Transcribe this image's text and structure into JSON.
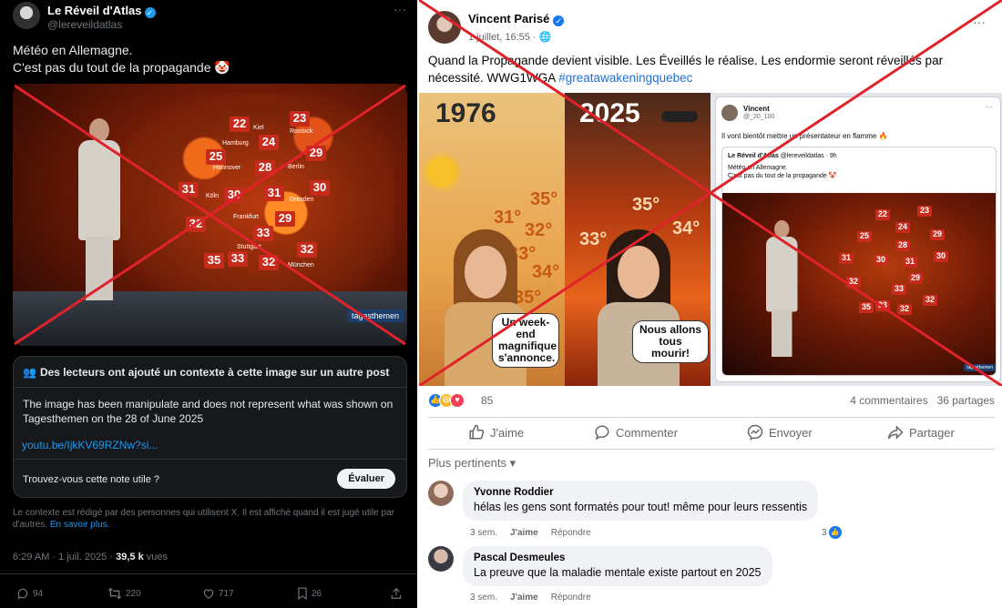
{
  "x_post": {
    "author_name": "Le Réveil d'Atlas",
    "author_handle": "@lereveildatlas",
    "more_label": "···",
    "text_lines": [
      "Météo en Allemagne.",
      "C'est pas du tout de la propagande 🤡"
    ],
    "image": {
      "channel_logo": "tagesthemen",
      "temperatures": [
        "22",
        "23",
        "24",
        "29",
        "25",
        "28",
        "30",
        "31",
        "30",
        "31",
        "32",
        "29",
        "33",
        "32",
        "35",
        "33",
        "32"
      ],
      "cities": [
        "Kiel",
        "Rostock",
        "Hamburg",
        "Hannover",
        "Berlin",
        "Köln",
        "Dresden",
        "Frankfurt",
        "Stuttgart",
        "München"
      ]
    },
    "community_note": {
      "header": "Des lecteurs ont ajouté un contexte à cette image sur un autre post",
      "body": "The image has been manipulate and does not represent what was shown on Tagesthemen on the  28 of June 2025",
      "link": "youtu.be/IjkKV69RZNw?si...",
      "question": "Trouvez-vous cette note utile ?",
      "rate_button": "Évaluer"
    },
    "disclaimer": "Le contexte est rédigé par des personnes qui utilisent X. Il est affiché quand il est jugé utile par d'autres.",
    "learn_more": "En savoir plus.",
    "timestamp": "6:29 AM · 1 juil. 2025 · ",
    "views_count": "39,5 k",
    "views_label": " vues",
    "actions": {
      "replies": "94",
      "reposts": "220",
      "likes": "717",
      "bookmarks": "26"
    },
    "icons": [
      "verified-badge-icon",
      "reply-icon",
      "repost-icon",
      "like-icon",
      "bookmark-icon",
      "share-icon",
      "people-icon"
    ]
  },
  "fb_post": {
    "author_name": "Vincent Parisé",
    "date": "1 juillet, 16:55 · 🌐",
    "more_label": "···",
    "text": "Quand la Propagande devient visible. Les Éveillés le réalise. Les endormie seront réveillés par nécessité. WWG1WGA ",
    "hashtag": "#greatawakeningquebec",
    "meme": {
      "year_left": "1976",
      "year_right": "2025",
      "temps_left": [
        "35°",
        "31°",
        "32°",
        "33°",
        "34°",
        "35°"
      ],
      "temps_right": [
        "35°",
        "33°",
        "34°"
      ],
      "caption_left": "Un week-end magnifique s'annonce.",
      "caption_right": "Nous allons tous mourir!"
    },
    "embedded_post": {
      "author": "Vincent",
      "handle": "@_20_100",
      "more_label": "···",
      "text": "Il vont bientôt mettre un présentateur en flamme 🔥",
      "quoted_author": "Le Réveil d'Atlas",
      "quoted_meta": " @lereveildatlas · 9h",
      "quoted_lines": [
        "Météo en Allemagne.",
        "C'est pas du tout de la propagande 🤡"
      ],
      "temperatures": [
        "22",
        "23",
        "24",
        "25",
        "28",
        "29",
        "30",
        "31",
        "31",
        "30",
        "32",
        "29",
        "33",
        "32",
        "35",
        "33",
        "32"
      ]
    },
    "reactions_count": "85",
    "comments_count": "4 commentaires",
    "shares_count": "36 partages",
    "buttons": {
      "like": "J'aime",
      "comment": "Commenter",
      "send": "Envoyer",
      "share": "Partager"
    },
    "filter_label": "Plus pertinents ▾",
    "comments": [
      {
        "author": "Yvonne Roddier",
        "text": "hélas les gens sont formatés pour tout! même pour leurs ressentis",
        "time": "3 sem.",
        "like": "J'aime",
        "reply": "Répondre",
        "likes": "3"
      },
      {
        "author": "Pascal Desmeules",
        "text": "La preuve que la maladie mentale existe partout en 2025",
        "time": "3 sem.",
        "like": "J'aime",
        "reply": "Répondre"
      }
    ],
    "icons": [
      "verified-badge-icon",
      "like-reaction-icon",
      "haha-reaction-icon",
      "love-reaction-icon",
      "thumbs-up-icon",
      "comment-icon",
      "messenger-icon",
      "share-arrow-icon"
    ]
  },
  "colors": {
    "x_background": "#000000",
    "x_link": "#1d9bf0",
    "fb_link": "#216fdb",
    "fb_blue": "#1877f2",
    "cross_red": "#e0232a",
    "temp_badge": "#c62b1c"
  }
}
